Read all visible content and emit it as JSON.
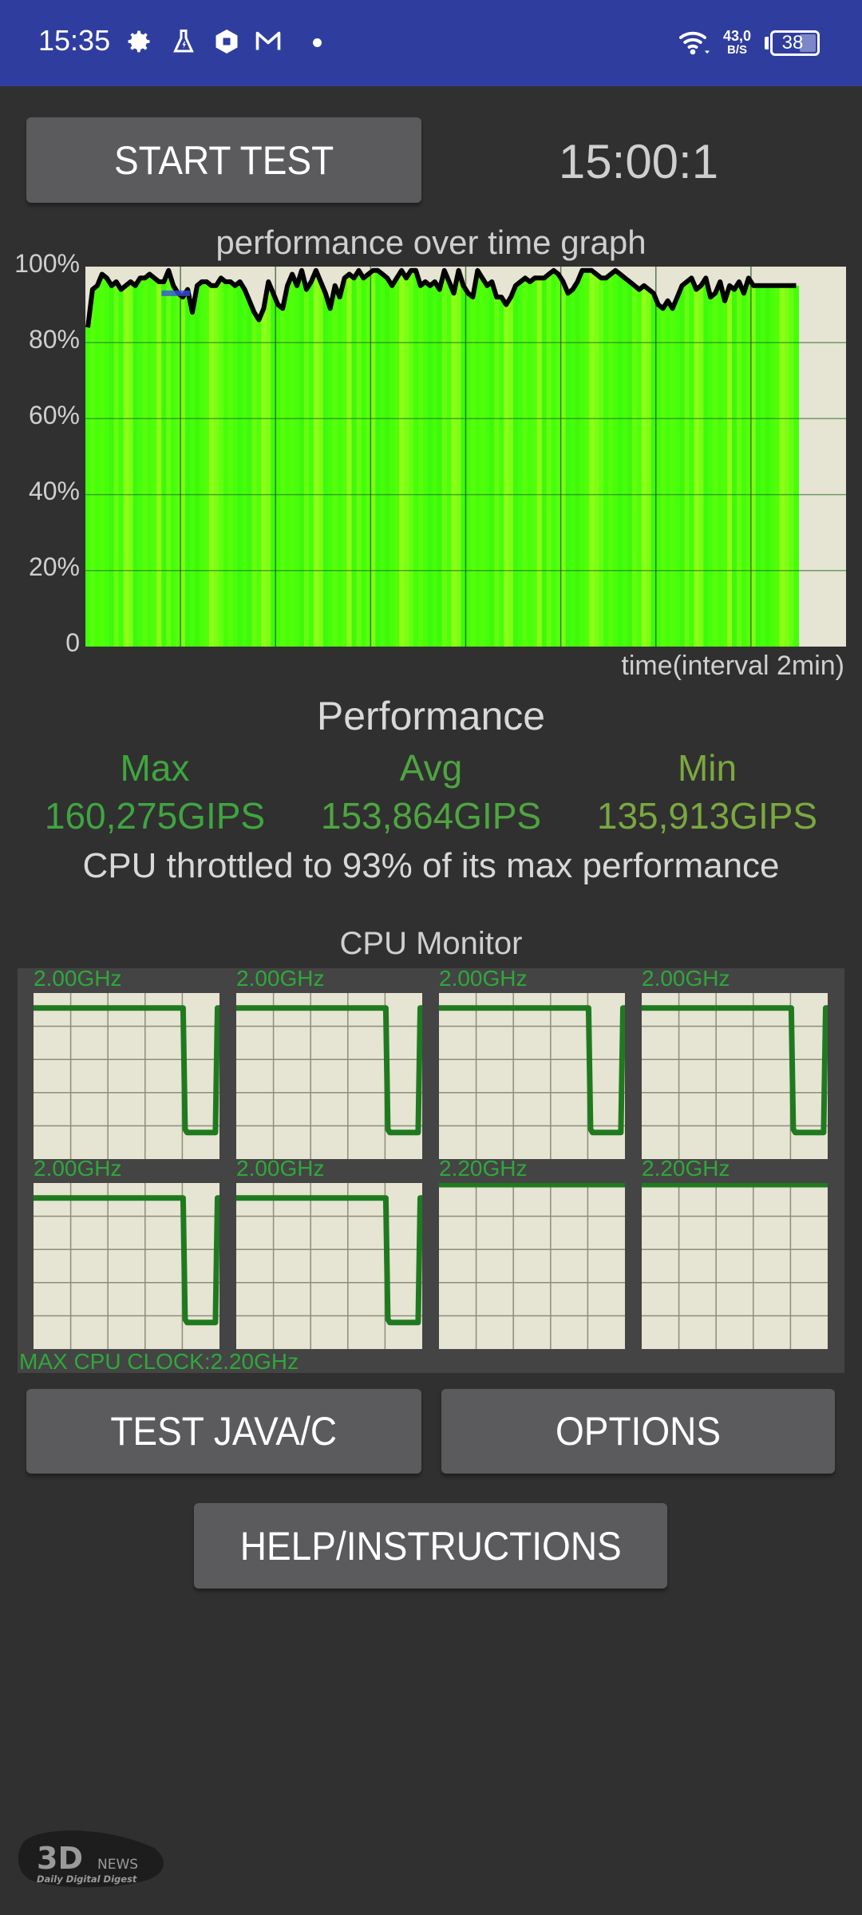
{
  "status_bar": {
    "time": "15:35",
    "icons": [
      "gear-icon",
      "flask-icon",
      "shield-hex-icon",
      "gmail-icon",
      "dot-icon"
    ],
    "wifi": "wifi-icon",
    "net_speed_value": "43,0",
    "net_speed_unit": "B/S",
    "battery_level": "38",
    "battery_percent": 38
  },
  "top": {
    "start_button": "START TEST",
    "timer": "15:00:1"
  },
  "graph": {
    "title": "performance over time graph",
    "x_label": "time(interval 2min)"
  },
  "performance": {
    "title": "Performance",
    "max_label": "Max",
    "max_value": "160,275GIPS",
    "avg_label": "Avg",
    "avg_value": "153,864GIPS",
    "min_label": "Min",
    "min_value": "135,913GIPS",
    "throttle_text": "CPU throttled to 93% of its max performance"
  },
  "cpu_monitor": {
    "title": "CPU Monitor",
    "max_clock": "MAX CPU CLOCK:2.20GHz",
    "cores": [
      {
        "freq": "2.00GHz",
        "history": [
          0.91,
          0.91,
          0.91,
          0.91,
          0.91,
          0.91,
          0.91,
          0.91,
          0.91,
          0.91,
          0.91,
          0.91,
          0.91,
          0.91,
          0.91,
          0.91,
          0.91,
          0.91,
          0.91,
          0.91,
          0.91,
          0.91,
          0.91,
          0.91,
          0.91,
          0.91,
          0.91,
          0.91,
          0.91,
          0.91,
          0.91,
          0.91,
          0.91,
          0.91,
          0.91,
          0.91,
          0.91,
          0.91,
          0.91,
          0.91,
          0.91,
          0.91,
          0.91,
          0.91,
          0.91,
          0.91,
          0.91,
          0.91,
          0.91,
          0.91,
          0.91,
          0.91,
          0.91,
          0.91,
          0.91,
          0.91,
          0.91,
          0.91,
          0.91,
          0.91,
          0.91,
          0.91,
          0.91,
          0.91,
          0.91,
          0.91,
          0.91,
          0.91,
          0.91,
          0.91,
          0.91,
          0.91,
          0.91,
          0.91,
          0.91,
          0.18,
          0.16,
          0.16,
          0.16,
          0.16,
          0.16,
          0.16,
          0.16,
          0.16,
          0.16,
          0.16,
          0.16,
          0.16,
          0.16,
          0.16,
          0.16,
          0.91,
          0.91
        ]
      },
      {
        "freq": "2.00GHz",
        "history": "same"
      },
      {
        "freq": "2.00GHz",
        "history": "same"
      },
      {
        "freq": "2.00GHz",
        "history": "same"
      },
      {
        "freq": "2.00GHz",
        "history": "same"
      },
      {
        "freq": "2.00GHz",
        "history": "same"
      },
      {
        "freq": "2.20GHz",
        "history": "full"
      },
      {
        "freq": "2.20GHz",
        "history": "full"
      }
    ]
  },
  "buttons": {
    "test_java": "TEST JAVA/C",
    "options": "OPTIONS",
    "help": "HELP/INSTRUCTIONS"
  },
  "watermark": {
    "brand": "3D",
    "news": "NEWS",
    "tagline": "Daily Digital Digest"
  },
  "colors": {
    "status_bar": "#2f3e9e",
    "background": "#303030",
    "button": "#5b5b5d",
    "graph_bg": "#e6e4d2",
    "graph_fill": "#44ff0a",
    "graph_line": "#000000",
    "max_color": "#3fa53f",
    "avg_color": "#4ea540",
    "min_color": "#7aa83e",
    "cpu_line": "#1f7a1f"
  },
  "chart_data": {
    "type": "area",
    "title": "performance over time graph",
    "xlabel": "time(interval 2min)",
    "ylabel": "",
    "yticks": [
      "0",
      "20%",
      "40%",
      "60%",
      "80%",
      "100%"
    ],
    "ylim": [
      0,
      100
    ],
    "x_range_minutes": [
      0,
      16
    ],
    "grid": true,
    "series": [
      {
        "name": "performance",
        "x_minutes": [
          0,
          0.1,
          0.2,
          0.3,
          0.4,
          0.5,
          0.6,
          0.7,
          0.8,
          0.9,
          1.0,
          1.1,
          1.2,
          1.3,
          1.4,
          1.5,
          1.6,
          1.7,
          1.8,
          1.9,
          2.0,
          2.1,
          2.2,
          2.3,
          2.4,
          2.5,
          2.6,
          2.7,
          2.8,
          2.9,
          3.0,
          3.1,
          3.2,
          3.3,
          3.4,
          3.5,
          3.6,
          3.7,
          3.8,
          3.9,
          4.0,
          4.1,
          4.2,
          4.3,
          4.4,
          4.5,
          4.6,
          4.7,
          4.8,
          4.9,
          5.0,
          5.1,
          5.2,
          5.3,
          5.4,
          5.5,
          5.6,
          5.7,
          5.8,
          5.9,
          6.0,
          6.1,
          6.2,
          6.3,
          6.4,
          6.5,
          6.6,
          6.7,
          6.8,
          6.9,
          7.0,
          7.1,
          7.2,
          7.3,
          7.4,
          7.5,
          7.6,
          7.7,
          7.8,
          7.9,
          8.0,
          8.1,
          8.2,
          8.3,
          8.4,
          8.5,
          8.6,
          8.7,
          8.8,
          8.9,
          9.0,
          9.1,
          9.2,
          9.3,
          9.4,
          9.5,
          9.6,
          9.7,
          9.8,
          9.9,
          10.0,
          10.1,
          10.2,
          10.3,
          10.4,
          10.5,
          10.6,
          10.7,
          10.8,
          10.9,
          11.0,
          11.1,
          11.2,
          11.3,
          11.4,
          11.5,
          11.6,
          11.7,
          11.8,
          11.9,
          12.0,
          12.1,
          12.2,
          12.3,
          12.4,
          12.5,
          12.6,
          12.7,
          12.8,
          12.9,
          13.0,
          13.1,
          13.2,
          13.3,
          13.4,
          13.5,
          13.6,
          13.7,
          13.8,
          13.9,
          14.0,
          14.1,
          14.2,
          14.3,
          14.4,
          14.5,
          14.6,
          14.7,
          14.8,
          14.9
        ],
        "values": [
          84,
          94,
          95,
          98,
          97,
          95,
          96,
          94,
          95,
          96,
          95,
          97,
          97,
          98,
          97,
          96,
          96,
          99,
          95,
          93,
          92,
          94,
          88,
          95,
          96,
          96,
          95,
          95,
          97,
          96,
          96,
          95,
          96,
          94,
          91,
          88,
          86,
          89,
          96,
          93,
          90,
          89,
          95,
          98,
          95,
          99,
          94,
          96,
          99,
          96,
          93,
          89,
          95,
          92,
          97,
          98,
          97,
          99,
          97,
          98,
          99,
          99,
          98,
          97,
          95,
          97,
          99,
          97,
          99,
          99,
          95,
          96,
          95,
          96,
          94,
          99,
          96,
          93,
          99,
          95,
          93,
          92,
          99,
          97,
          95,
          96,
          92,
          92,
          90,
          92,
          95,
          96,
          97,
          96,
          97,
          97,
          97,
          98,
          99,
          98,
          96,
          93,
          94,
          96,
          99,
          99,
          99,
          98,
          97,
          97,
          98,
          99,
          98,
          97,
          96,
          95,
          94,
          95,
          94,
          93,
          90,
          89,
          91,
          89,
          92,
          95,
          96,
          97,
          94,
          95,
          97,
          92,
          93,
          96,
          91,
          95,
          94,
          96,
          93,
          97,
          95,
          95,
          95,
          95,
          95,
          95,
          95,
          95,
          95,
          95
        ],
        "fill_color": "#44ff0a",
        "line_color": "#000000"
      },
      {
        "name": "average-marker",
        "x_minutes": [
          1.6,
          2.2
        ],
        "values": [
          93,
          93
        ],
        "line_color": "#3a4fe0"
      }
    ]
  }
}
